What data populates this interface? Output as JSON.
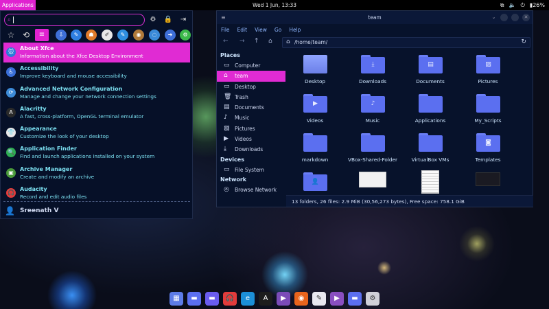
{
  "topbar": {
    "apps_label": "Applications",
    "clock": "Wed  1 Jun, 13:33",
    "battery": "26%",
    "tray_icons": [
      "network-icon",
      "speaker-icon",
      "power-icon"
    ]
  },
  "menu": {
    "search_value": "",
    "top_icons": [
      "settings-icon",
      "lock-icon",
      "logout-icon"
    ],
    "categories": [
      "favorites",
      "recent",
      "all",
      "accessories",
      "development",
      "games",
      "graphics",
      "education",
      "multimedia",
      "internet",
      "office",
      "system"
    ],
    "apps": [
      {
        "name": "About Xfce",
        "desc": "Information about the Xfce Desktop Environment",
        "icon": "xfce-mouse-icon",
        "color": "#2a79d8",
        "glyph": "🐭"
      },
      {
        "name": "Accessibility",
        "desc": "Improve keyboard and mouse accessibility",
        "icon": "accessibility-icon",
        "color": "#3a6fd8",
        "glyph": "♿"
      },
      {
        "name": "Advanced Network Configuration",
        "desc": "Manage and change your network connection settings",
        "icon": "network-config-icon",
        "color": "#3d8bd8",
        "glyph": "⟳"
      },
      {
        "name": "Alacritty",
        "desc": "A fast, cross-platform, OpenGL terminal emulator",
        "icon": "alacritty-icon",
        "color": "#2a2a2a",
        "glyph": "A"
      },
      {
        "name": "Appearance",
        "desc": "Customize the look of your desktop",
        "icon": "appearance-shirt-icon",
        "color": "#e8e8e8",
        "glyph": "👕"
      },
      {
        "name": "Application Finder",
        "desc": "Find and launch applications installed on your system",
        "icon": "app-finder-icon",
        "color": "#2fae54",
        "glyph": "🔍"
      },
      {
        "name": "Archive Manager",
        "desc": "Create and modify an archive",
        "icon": "archive-icon",
        "color": "#4a9a3a",
        "glyph": "▣"
      },
      {
        "name": "Audacity",
        "desc": "Record and edit audio files",
        "icon": "audacity-icon",
        "color": "#e23b3b",
        "glyph": "🎧"
      }
    ],
    "user": "Sreenath V"
  },
  "filemanager": {
    "title": "team",
    "menubar": [
      "File",
      "Edit",
      "View",
      "Go",
      "Help"
    ],
    "path": "/home/team/",
    "sidebar": {
      "places_header": "Places",
      "places": [
        {
          "label": "Computer",
          "icon": "computer-icon",
          "glyph": "▭"
        },
        {
          "label": "team",
          "icon": "home-icon",
          "glyph": "⌂",
          "active": true
        },
        {
          "label": "Desktop",
          "icon": "desktop-icon",
          "glyph": "▭"
        },
        {
          "label": "Trash",
          "icon": "trash-icon",
          "glyph": "🗑"
        },
        {
          "label": "Documents",
          "icon": "documents-icon",
          "glyph": "▤"
        },
        {
          "label": "Music",
          "icon": "music-icon",
          "glyph": "♪"
        },
        {
          "label": "Pictures",
          "icon": "pictures-icon",
          "glyph": "▨"
        },
        {
          "label": "Videos",
          "icon": "videos-icon",
          "glyph": "▶"
        },
        {
          "label": "Downloads",
          "icon": "downloads-icon",
          "glyph": "⤓"
        }
      ],
      "devices_header": "Devices",
      "devices": [
        {
          "label": "File System",
          "icon": "drive-icon",
          "glyph": "▭"
        }
      ],
      "network_header": "Network",
      "network": [
        {
          "label": "Browse Network",
          "icon": "network-browse-icon",
          "glyph": "◎"
        }
      ]
    },
    "files": [
      {
        "name": "Desktop",
        "kind": "desktop"
      },
      {
        "name": "Downloads",
        "kind": "folder",
        "emblem": "⤓"
      },
      {
        "name": "Documents",
        "kind": "folder",
        "emblem": "▤"
      },
      {
        "name": "Pictures",
        "kind": "folder",
        "emblem": "▨"
      },
      {
        "name": "Videos",
        "kind": "folder",
        "emblem": "▶"
      },
      {
        "name": "Music",
        "kind": "folder",
        "emblem": "♪"
      },
      {
        "name": "Applications",
        "kind": "folder",
        "emblem": ""
      },
      {
        "name": "My_Scripts",
        "kind": "folder",
        "emblem": ""
      },
      {
        "name": "markdown",
        "kind": "folder",
        "emblem": ""
      },
      {
        "name": "VBox-Shared-Folder",
        "kind": "folder",
        "emblem": ""
      },
      {
        "name": "VirtualBox VMs",
        "kind": "folder",
        "emblem": ""
      },
      {
        "name": "Templates",
        "kind": "folder",
        "emblem": "◙"
      },
      {
        "name": "",
        "kind": "folder",
        "emblem": "👤"
      },
      {
        "name": "",
        "kind": "image-light"
      },
      {
        "name": "",
        "kind": "image-doc"
      },
      {
        "name": "",
        "kind": "image-dark"
      }
    ],
    "status": "13 folders, 26 files: 2.9 MiB (30,56,273 bytes), Free space: 758.1 GiB"
  },
  "dock": [
    {
      "name": "dock-app-grid-icon",
      "color": "#5d7ce8",
      "glyph": "▦"
    },
    {
      "name": "dock-folder-icon",
      "color": "#5b6ff0",
      "glyph": "▬"
    },
    {
      "name": "dock-folder2-icon",
      "color": "#6a5cf0",
      "glyph": "▬"
    },
    {
      "name": "dock-audacity-icon",
      "color": "#e23b3b",
      "glyph": "🎧"
    },
    {
      "name": "dock-edge-icon",
      "color": "#1c8fd8",
      "glyph": "e"
    },
    {
      "name": "dock-alacritty-icon",
      "color": "#1d1d1d",
      "glyph": "A"
    },
    {
      "name": "dock-video-icon",
      "color": "#7b4bb8",
      "glyph": "▶"
    },
    {
      "name": "dock-firefox-icon",
      "color": "#e8641c",
      "glyph": "◉"
    },
    {
      "name": "dock-editor-icon",
      "color": "#e8e8f0",
      "glyph": "✎"
    },
    {
      "name": "dock-media-icon",
      "color": "#8a4fc0",
      "glyph": "▶"
    },
    {
      "name": "dock-folder3-icon",
      "color": "#5b6ff0",
      "glyph": "▬"
    },
    {
      "name": "dock-settings-icon",
      "color": "#d0d0d8",
      "glyph": "⚙"
    }
  ],
  "colors": {
    "accent": "#e022d0",
    "text_accent": "#7ce1f2",
    "folder": "#5b6ff0",
    "panel": "#061028"
  }
}
